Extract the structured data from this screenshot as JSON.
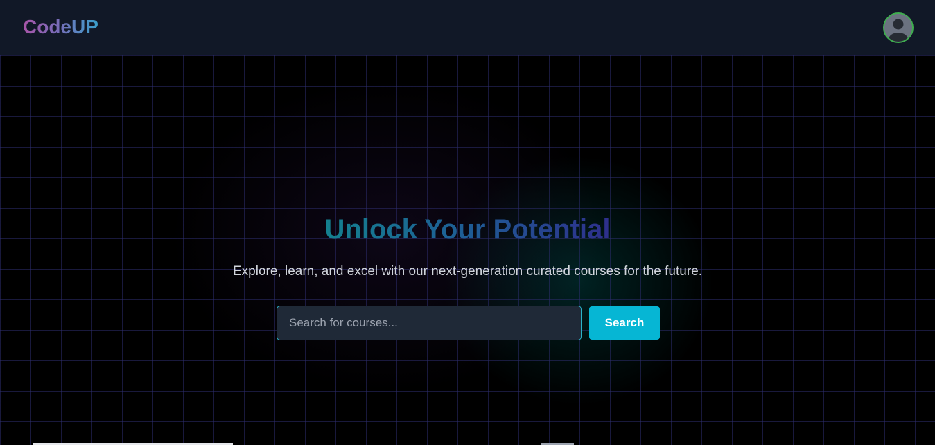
{
  "navbar": {
    "brand": "CodeUP",
    "avatar_icon": "user-avatar-icon"
  },
  "hero": {
    "title": "Unlock Your Potential",
    "subtitle": "Explore, learn, and excel with our next-generation curated courses for the future."
  },
  "search": {
    "placeholder": "Search for courses...",
    "value": "",
    "button_label": "Search"
  },
  "colors": {
    "navbar_bg": "#111827",
    "page_bg": "#000000",
    "accent": "#06b6d4",
    "avatar_ring": "#3fae4f",
    "title_gradient_start": "#14808f",
    "title_gradient_end": "#2e2f8c",
    "brand_gradient_start": "#a855a8",
    "brand_gradient_end": "#3aa0cc"
  }
}
